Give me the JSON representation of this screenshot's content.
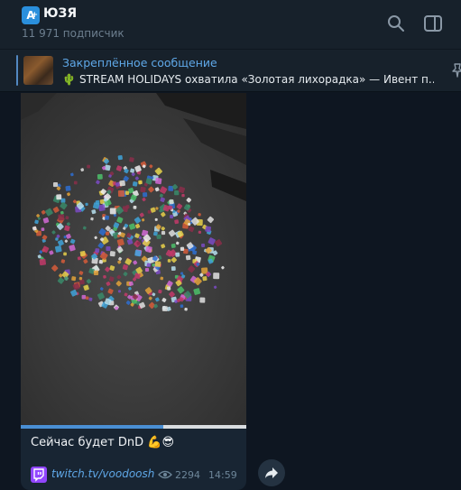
{
  "header": {
    "avatar_letter": "A",
    "title": "ЮЗЯ",
    "subtitle": "11 971 подписчик",
    "icons": [
      "search-icon",
      "sidebar-toggle-icon"
    ]
  },
  "pinned": {
    "title": "Закреплённое сообщение",
    "text": "STREAM HOLIDAYS охватила «Золотая лихорадка» — Ивент п...",
    "icon": "cactus-emoji"
  },
  "message": {
    "video_progress": 0.63,
    "caption": "Сейчас будет DnD",
    "caption_emoji": "💪😎",
    "link": "twitch.tv/voodoosh",
    "views": "2294",
    "time": "14:59"
  },
  "colors": {
    "background": "#0e1621",
    "header": "#17212b",
    "accent": "#5fa8e8",
    "bubble": "#182533",
    "twitch": "#9146ff"
  }
}
